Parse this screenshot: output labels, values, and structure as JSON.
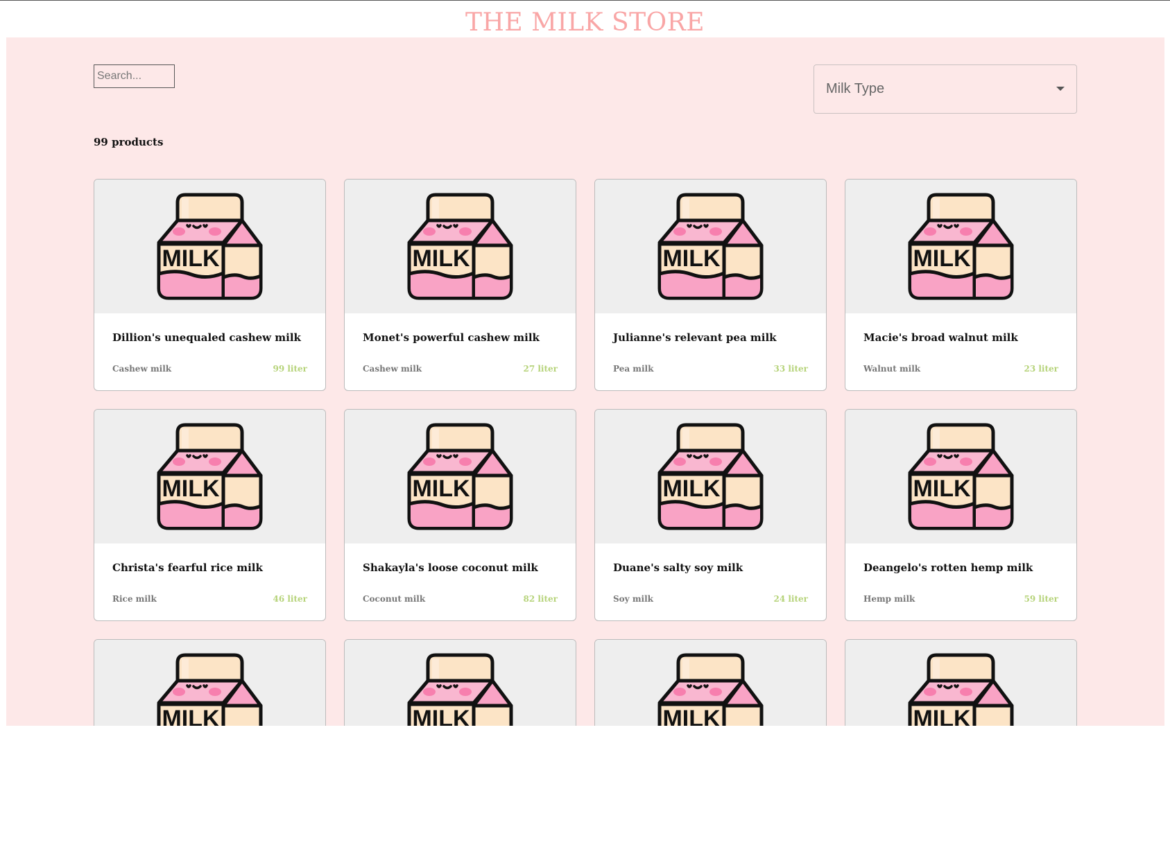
{
  "header": {
    "title": "THE MILK STORE"
  },
  "search": {
    "placeholder": "Search..."
  },
  "filter": {
    "label": "Milk Type"
  },
  "results": {
    "count_label": "99 products"
  },
  "product_image": {
    "icon": "milk-carton-icon",
    "text": "MILK"
  },
  "colors": {
    "title": "#f9a6a6",
    "panel_background": "#fde8e8",
    "image_background": "#eeeeee",
    "volume_text": "#b6d37a",
    "carton_pink": "#f9a3c5",
    "carton_cream": "#fce4c6"
  },
  "products": [
    {
      "name": "Dillion's unequaled cashew milk",
      "type": "Cashew milk",
      "volume": "99 liter"
    },
    {
      "name": "Monet's powerful cashew milk",
      "type": "Cashew milk",
      "volume": "27 liter"
    },
    {
      "name": "Julianne's relevant pea milk",
      "type": "Pea milk",
      "volume": "33 liter"
    },
    {
      "name": "Macie's broad walnut milk",
      "type": "Walnut milk",
      "volume": "23 liter"
    },
    {
      "name": "Christa's fearful rice milk",
      "type": "Rice milk",
      "volume": "46 liter"
    },
    {
      "name": "Shakayla's loose coconut milk",
      "type": "Coconut milk",
      "volume": "82 liter"
    },
    {
      "name": "Duane's salty soy milk",
      "type": "Soy milk",
      "volume": "24 liter"
    },
    {
      "name": "Deangelo's rotten hemp milk",
      "type": "Hemp milk",
      "volume": "59 liter"
    },
    {
      "name": "",
      "type": "",
      "volume": ""
    },
    {
      "name": "",
      "type": "",
      "volume": ""
    },
    {
      "name": "",
      "type": "",
      "volume": ""
    },
    {
      "name": "",
      "type": "",
      "volume": ""
    }
  ]
}
